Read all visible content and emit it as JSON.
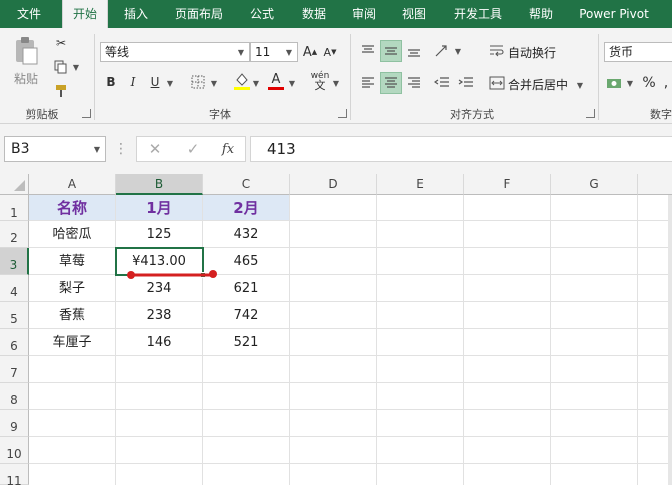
{
  "menu": {
    "tabs": [
      "文件",
      "开始",
      "插入",
      "页面布局",
      "公式",
      "数据",
      "审阅",
      "视图",
      "开发工具",
      "帮助",
      "Power Pivot"
    ]
  },
  "ribbon": {
    "clipboard": {
      "paste_label": "粘贴",
      "group_label": "剪贴板"
    },
    "font": {
      "font_name": "等线",
      "font_size": "11",
      "grow_label": "A",
      "shrink_label": "A",
      "bold": "B",
      "italic": "I",
      "underline": "U",
      "phonetic": "wén",
      "group_label": "字体"
    },
    "alignment": {
      "wrap_label": "自动换行",
      "merge_label": "合并后居中",
      "group_label": "对齐方式"
    },
    "number": {
      "format": "货币",
      "percent": "%",
      "group_label": "数字"
    }
  },
  "formula_bar": {
    "name_box": "B3",
    "fx": "fx",
    "value": "413"
  },
  "columns": [
    "A",
    "B",
    "C",
    "D",
    "E",
    "F",
    "G"
  ],
  "rows": [
    "1",
    "2",
    "3",
    "4",
    "5",
    "6",
    "7",
    "8",
    "9",
    "10",
    "11"
  ],
  "table": {
    "header": [
      "名称",
      "1月",
      "2月"
    ],
    "data": [
      [
        "哈密瓜",
        "125",
        "432"
      ],
      [
        "草莓",
        "¥413.00",
        "465"
      ],
      [
        "梨子",
        "234",
        "621"
      ],
      [
        "香蕉",
        "238",
        "742"
      ],
      [
        "车厘子",
        "146",
        "521"
      ]
    ]
  },
  "colors": {
    "brand": "#217346",
    "header_fill": "#dde8f5",
    "header_text": "#7030a0",
    "underline_mark": "#d42020"
  }
}
